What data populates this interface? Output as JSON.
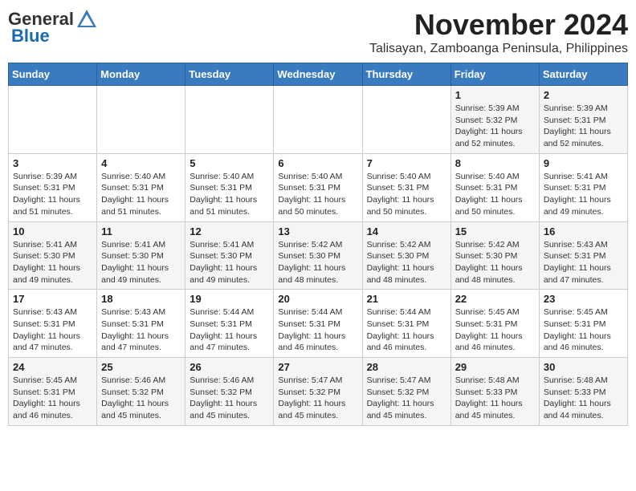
{
  "logo": {
    "general": "General",
    "blue": "Blue"
  },
  "title": "November 2024",
  "subtitle": "Talisayan, Zamboanga Peninsula, Philippines",
  "weekdays": [
    "Sunday",
    "Monday",
    "Tuesday",
    "Wednesday",
    "Thursday",
    "Friday",
    "Saturday"
  ],
  "weeks": [
    [
      {
        "day": "",
        "sunrise": "",
        "sunset": "",
        "daylight": ""
      },
      {
        "day": "",
        "sunrise": "",
        "sunset": "",
        "daylight": ""
      },
      {
        "day": "",
        "sunrise": "",
        "sunset": "",
        "daylight": ""
      },
      {
        "day": "",
        "sunrise": "",
        "sunset": "",
        "daylight": ""
      },
      {
        "day": "",
        "sunrise": "",
        "sunset": "",
        "daylight": ""
      },
      {
        "day": "1",
        "sunrise": "Sunrise: 5:39 AM",
        "sunset": "Sunset: 5:32 PM",
        "daylight": "Daylight: 11 hours and 52 minutes."
      },
      {
        "day": "2",
        "sunrise": "Sunrise: 5:39 AM",
        "sunset": "Sunset: 5:31 PM",
        "daylight": "Daylight: 11 hours and 52 minutes."
      }
    ],
    [
      {
        "day": "3",
        "sunrise": "Sunrise: 5:39 AM",
        "sunset": "Sunset: 5:31 PM",
        "daylight": "Daylight: 11 hours and 51 minutes."
      },
      {
        "day": "4",
        "sunrise": "Sunrise: 5:40 AM",
        "sunset": "Sunset: 5:31 PM",
        "daylight": "Daylight: 11 hours and 51 minutes."
      },
      {
        "day": "5",
        "sunrise": "Sunrise: 5:40 AM",
        "sunset": "Sunset: 5:31 PM",
        "daylight": "Daylight: 11 hours and 51 minutes."
      },
      {
        "day": "6",
        "sunrise": "Sunrise: 5:40 AM",
        "sunset": "Sunset: 5:31 PM",
        "daylight": "Daylight: 11 hours and 50 minutes."
      },
      {
        "day": "7",
        "sunrise": "Sunrise: 5:40 AM",
        "sunset": "Sunset: 5:31 PM",
        "daylight": "Daylight: 11 hours and 50 minutes."
      },
      {
        "day": "8",
        "sunrise": "Sunrise: 5:40 AM",
        "sunset": "Sunset: 5:31 PM",
        "daylight": "Daylight: 11 hours and 50 minutes."
      },
      {
        "day": "9",
        "sunrise": "Sunrise: 5:41 AM",
        "sunset": "Sunset: 5:31 PM",
        "daylight": "Daylight: 11 hours and 49 minutes."
      }
    ],
    [
      {
        "day": "10",
        "sunrise": "Sunrise: 5:41 AM",
        "sunset": "Sunset: 5:30 PM",
        "daylight": "Daylight: 11 hours and 49 minutes."
      },
      {
        "day": "11",
        "sunrise": "Sunrise: 5:41 AM",
        "sunset": "Sunset: 5:30 PM",
        "daylight": "Daylight: 11 hours and 49 minutes."
      },
      {
        "day": "12",
        "sunrise": "Sunrise: 5:41 AM",
        "sunset": "Sunset: 5:30 PM",
        "daylight": "Daylight: 11 hours and 49 minutes."
      },
      {
        "day": "13",
        "sunrise": "Sunrise: 5:42 AM",
        "sunset": "Sunset: 5:30 PM",
        "daylight": "Daylight: 11 hours and 48 minutes."
      },
      {
        "day": "14",
        "sunrise": "Sunrise: 5:42 AM",
        "sunset": "Sunset: 5:30 PM",
        "daylight": "Daylight: 11 hours and 48 minutes."
      },
      {
        "day": "15",
        "sunrise": "Sunrise: 5:42 AM",
        "sunset": "Sunset: 5:30 PM",
        "daylight": "Daylight: 11 hours and 48 minutes."
      },
      {
        "day": "16",
        "sunrise": "Sunrise: 5:43 AM",
        "sunset": "Sunset: 5:31 PM",
        "daylight": "Daylight: 11 hours and 47 minutes."
      }
    ],
    [
      {
        "day": "17",
        "sunrise": "Sunrise: 5:43 AM",
        "sunset": "Sunset: 5:31 PM",
        "daylight": "Daylight: 11 hours and 47 minutes."
      },
      {
        "day": "18",
        "sunrise": "Sunrise: 5:43 AM",
        "sunset": "Sunset: 5:31 PM",
        "daylight": "Daylight: 11 hours and 47 minutes."
      },
      {
        "day": "19",
        "sunrise": "Sunrise: 5:44 AM",
        "sunset": "Sunset: 5:31 PM",
        "daylight": "Daylight: 11 hours and 47 minutes."
      },
      {
        "day": "20",
        "sunrise": "Sunrise: 5:44 AM",
        "sunset": "Sunset: 5:31 PM",
        "daylight": "Daylight: 11 hours and 46 minutes."
      },
      {
        "day": "21",
        "sunrise": "Sunrise: 5:44 AM",
        "sunset": "Sunset: 5:31 PM",
        "daylight": "Daylight: 11 hours and 46 minutes."
      },
      {
        "day": "22",
        "sunrise": "Sunrise: 5:45 AM",
        "sunset": "Sunset: 5:31 PM",
        "daylight": "Daylight: 11 hours and 46 minutes."
      },
      {
        "day": "23",
        "sunrise": "Sunrise: 5:45 AM",
        "sunset": "Sunset: 5:31 PM",
        "daylight": "Daylight: 11 hours and 46 minutes."
      }
    ],
    [
      {
        "day": "24",
        "sunrise": "Sunrise: 5:45 AM",
        "sunset": "Sunset: 5:31 PM",
        "daylight": "Daylight: 11 hours and 46 minutes."
      },
      {
        "day": "25",
        "sunrise": "Sunrise: 5:46 AM",
        "sunset": "Sunset: 5:32 PM",
        "daylight": "Daylight: 11 hours and 45 minutes."
      },
      {
        "day": "26",
        "sunrise": "Sunrise: 5:46 AM",
        "sunset": "Sunset: 5:32 PM",
        "daylight": "Daylight: 11 hours and 45 minutes."
      },
      {
        "day": "27",
        "sunrise": "Sunrise: 5:47 AM",
        "sunset": "Sunset: 5:32 PM",
        "daylight": "Daylight: 11 hours and 45 minutes."
      },
      {
        "day": "28",
        "sunrise": "Sunrise: 5:47 AM",
        "sunset": "Sunset: 5:32 PM",
        "daylight": "Daylight: 11 hours and 45 minutes."
      },
      {
        "day": "29",
        "sunrise": "Sunrise: 5:48 AM",
        "sunset": "Sunset: 5:33 PM",
        "daylight": "Daylight: 11 hours and 45 minutes."
      },
      {
        "day": "30",
        "sunrise": "Sunrise: 5:48 AM",
        "sunset": "Sunset: 5:33 PM",
        "daylight": "Daylight: 11 hours and 44 minutes."
      }
    ]
  ]
}
